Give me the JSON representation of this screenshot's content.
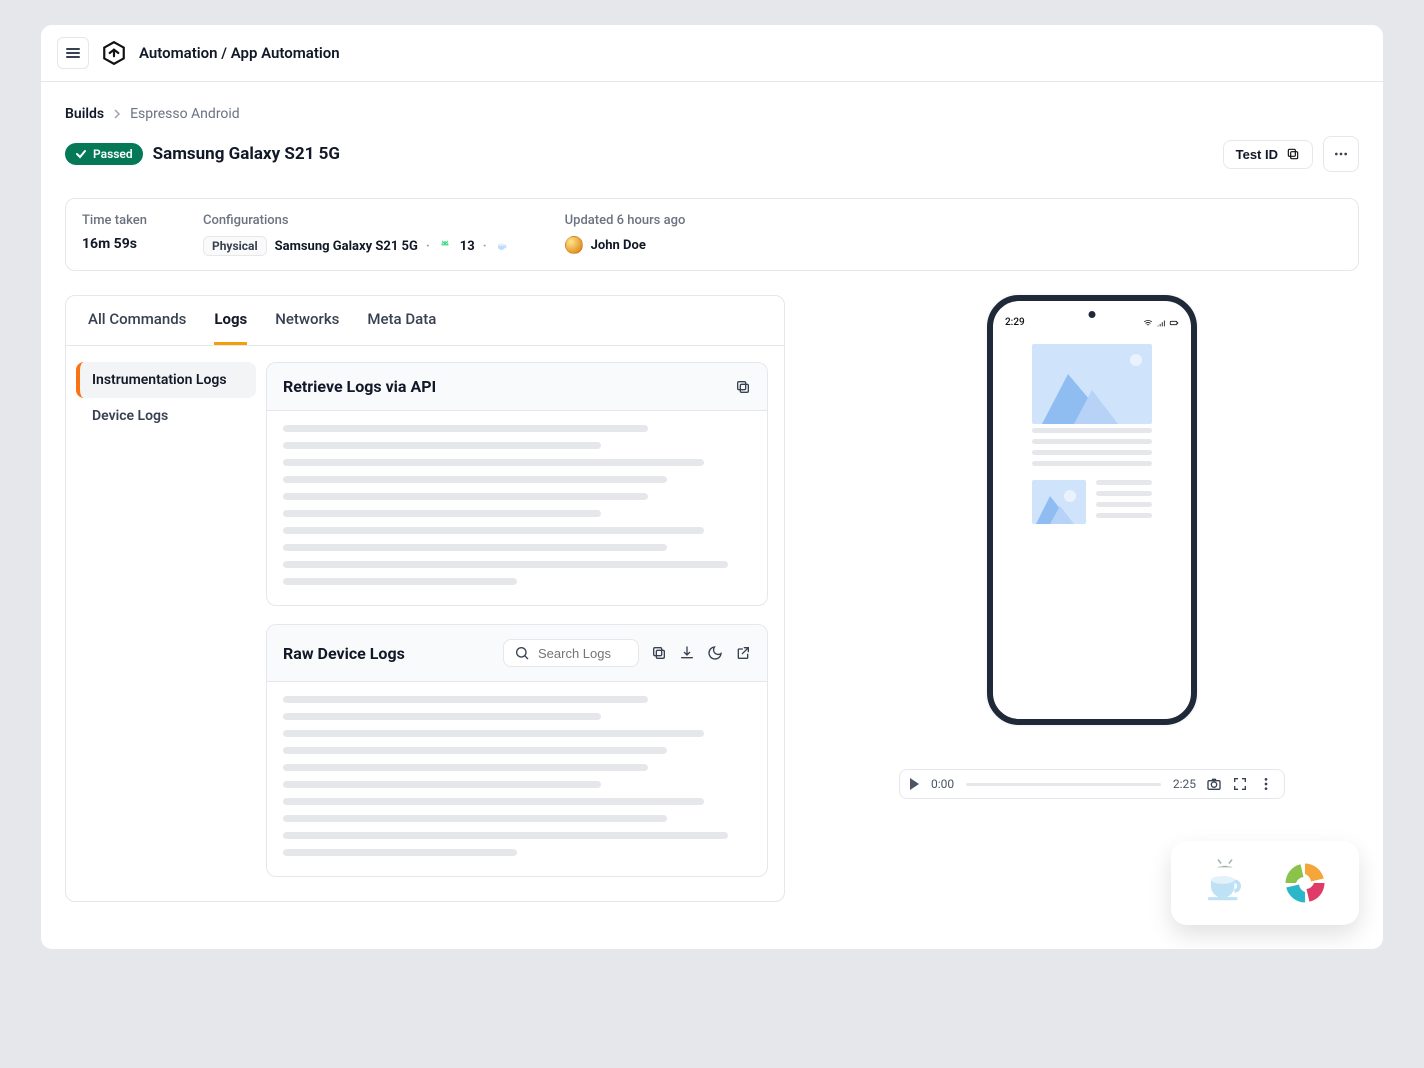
{
  "header": {
    "title": "Automation / App Automation"
  },
  "breadcrumb": {
    "root": "Builds",
    "leaf": "Espresso Android"
  },
  "status": {
    "label": "Passed"
  },
  "pageTitle": "Samsung Galaxy S21 5G",
  "titleActions": {
    "testIdLabel": "Test ID"
  },
  "info": {
    "timeTakenLabel": "Time taken",
    "timeTakenValue": "16m 59s",
    "configLabel": "Configurations",
    "configChip": "Physical",
    "configDevice": "Samsung Galaxy S21 5G",
    "configOsVersion": "13",
    "updatedLabel": "Updated 6 hours ago",
    "userName": "John Doe"
  },
  "tabs": {
    "allCommands": "All Commands",
    "logs": "Logs",
    "networks": "Networks",
    "metaData": "Meta Data"
  },
  "sideNav": {
    "instrumentation": "Instrumentation Logs",
    "device": "Device Logs"
  },
  "logCards": {
    "retrieveTitle": "Retrieve Logs via API",
    "rawTitle": "Raw Device Logs",
    "searchPlaceholder": "Search Logs"
  },
  "devicePreview": {
    "time": "2:29"
  },
  "player": {
    "current": "0:00",
    "duration": "2:25"
  }
}
